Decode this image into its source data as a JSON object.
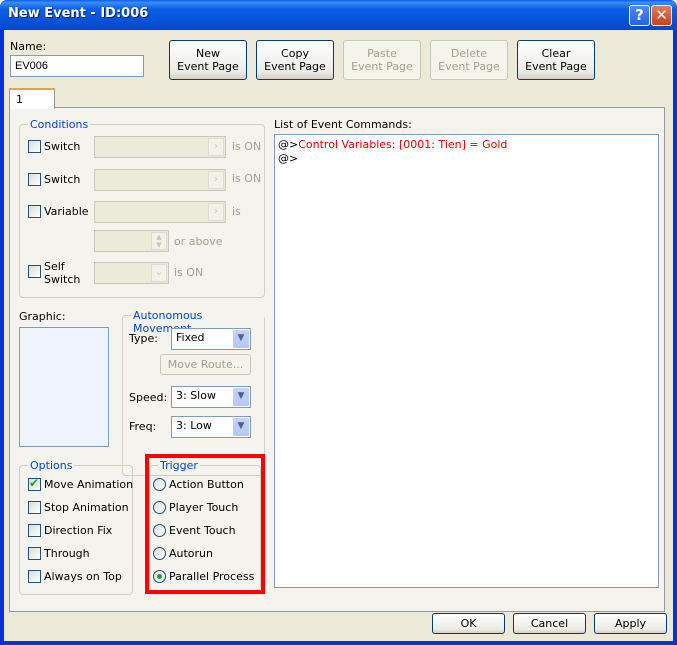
{
  "window": {
    "title": "New Event - ID:006",
    "help_icon": "?",
    "close_icon": "✕"
  },
  "name": {
    "label": "Name:",
    "value": "EV006"
  },
  "toolbar": {
    "new_page": [
      "New",
      "Event Page"
    ],
    "copy_page": [
      "Copy",
      "Event Page"
    ],
    "paste_page": [
      "Paste",
      "Event Page"
    ],
    "delete_page": [
      "Delete",
      "Event Page"
    ],
    "clear_page": [
      "Clear",
      "Event Page"
    ]
  },
  "tabs": [
    {
      "label": "1",
      "active": true
    }
  ],
  "conditions": {
    "title": "Conditions",
    "switch1": {
      "label": "Switch",
      "suffix": "is ON",
      "checked": false
    },
    "switch2": {
      "label": "Switch",
      "suffix": "is ON",
      "checked": false
    },
    "variable": {
      "label": "Variable",
      "suffix": "is",
      "checked": false
    },
    "or_above": "or above",
    "self_switch": {
      "label_line1": "Self",
      "label_line2": "Switch",
      "suffix": "is ON",
      "checked": false
    }
  },
  "graphic": {
    "label": "Graphic:"
  },
  "movement": {
    "title": "Autonomous Movement",
    "type_label": "Type:",
    "type_value": "Fixed",
    "move_route": "Move Route...",
    "speed_label": "Speed:",
    "speed_value": "3: Slow",
    "freq_label": "Freq:",
    "freq_value": "3: Low"
  },
  "options": {
    "title": "Options",
    "items": [
      {
        "label": "Move Animation",
        "checked": true
      },
      {
        "label": "Stop Animation",
        "checked": false
      },
      {
        "label": "Direction Fix",
        "checked": false
      },
      {
        "label": "Through",
        "checked": false
      },
      {
        "label": "Always on Top",
        "checked": false
      }
    ]
  },
  "trigger": {
    "title": "Trigger",
    "items": [
      {
        "label": "Action Button",
        "selected": false
      },
      {
        "label": "Player Touch",
        "selected": false
      },
      {
        "label": "Event Touch",
        "selected": false
      },
      {
        "label": "Autorun",
        "selected": false
      },
      {
        "label": "Parallel Process",
        "selected": true
      }
    ]
  },
  "commands": {
    "label": "List of Event Commands:",
    "lines": [
      {
        "prefix": "@>",
        "text": "Control Variables: [0001: Tien] = Gold",
        "color": "#e00000"
      },
      {
        "prefix": "@>",
        "text": "",
        "color": "#000000"
      }
    ]
  },
  "footer": {
    "ok": "OK",
    "cancel": "Cancel",
    "apply": "Apply"
  },
  "highlight_color": "#ff0000"
}
